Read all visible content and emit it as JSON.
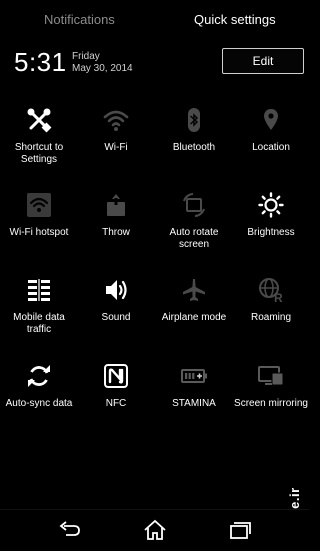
{
  "tabs": {
    "notifications": "Notifications",
    "quick_settings": "Quick settings"
  },
  "status": {
    "time": "5:31",
    "weekday": "Friday",
    "date": "May 30, 2014"
  },
  "edit_label": "Edit",
  "tiles": [
    {
      "label": "Shortcut to Settings",
      "icon": "settings-tools-icon",
      "state": "on"
    },
    {
      "label": "Wi-Fi",
      "icon": "wifi-icon",
      "state": "off"
    },
    {
      "label": "Bluetooth",
      "icon": "bluetooth-icon",
      "state": "off"
    },
    {
      "label": "Location",
      "icon": "location-icon",
      "state": "off"
    },
    {
      "label": "Wi-Fi hotspot",
      "icon": "wifi-hotspot-icon",
      "state": "off"
    },
    {
      "label": "Throw",
      "icon": "throw-icon",
      "state": "off"
    },
    {
      "label": "Auto rotate screen",
      "icon": "auto-rotate-icon",
      "state": "off"
    },
    {
      "label": "Brightness",
      "icon": "brightness-icon",
      "state": "on"
    },
    {
      "label": "Mobile data traffic",
      "icon": "mobile-data-icon",
      "state": "on"
    },
    {
      "label": "Sound",
      "icon": "sound-icon",
      "state": "on"
    },
    {
      "label": "Airplane mode",
      "icon": "airplane-icon",
      "state": "off"
    },
    {
      "label": "Roaming",
      "icon": "roaming-icon",
      "state": "off"
    },
    {
      "label": "Auto-sync data",
      "icon": "sync-icon",
      "state": "on"
    },
    {
      "label": "NFC",
      "icon": "nfc-icon",
      "state": "on"
    },
    {
      "label": "STAMINA",
      "icon": "stamina-battery-icon",
      "state": "off"
    },
    {
      "label": "Screen mirroring",
      "icon": "screen-mirroring-icon",
      "state": "off"
    }
  ],
  "nav": [
    "back-icon",
    "home-icon",
    "recent-apps-icon"
  ],
  "watermark": "mobile.ir",
  "colors": {
    "on": "#ffffff",
    "off": "#5a5a5a",
    "background": "#000000"
  }
}
